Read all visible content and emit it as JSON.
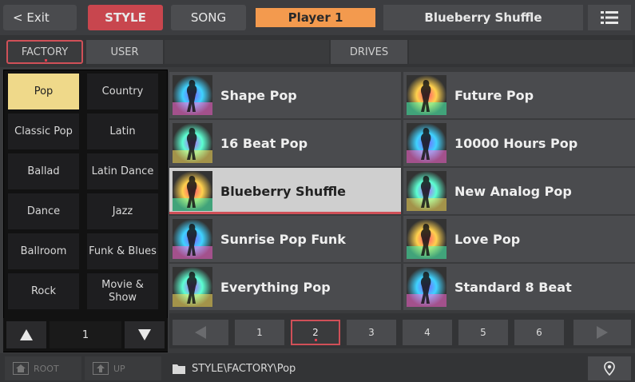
{
  "header": {
    "exit_label": "< Exit",
    "style_tab": "STYLE",
    "song_tab": "SONG",
    "player": "Player 1",
    "current_style": "Blueberry Shuffle",
    "menu_icon": "list-menu-icon"
  },
  "tabs": {
    "factory": "FACTORY",
    "user": "USER",
    "drives": "DRIVES"
  },
  "categories": [
    {
      "label": "Pop",
      "selected": true
    },
    {
      "label": "Country",
      "selected": false
    },
    {
      "label": "Classic Pop",
      "selected": false
    },
    {
      "label": "Latin",
      "selected": false
    },
    {
      "label": "Ballad",
      "selected": false
    },
    {
      "label": "Latin Dance",
      "selected": false
    },
    {
      "label": "Dance",
      "selected": false
    },
    {
      "label": "Jazz",
      "selected": false
    },
    {
      "label": "Ballroom",
      "selected": false
    },
    {
      "label": "Funk & Blues",
      "selected": false
    },
    {
      "label": "Rock",
      "selected": false
    },
    {
      "label": "Movie & Show",
      "selected": false
    }
  ],
  "category_page": "1",
  "styles": [
    {
      "name": "Shape Pop",
      "selected": false
    },
    {
      "name": "Future Pop",
      "selected": false
    },
    {
      "name": "16 Beat Pop",
      "selected": false
    },
    {
      "name": "10000 Hours Pop",
      "selected": false
    },
    {
      "name": "Blueberry Shuffle",
      "selected": true
    },
    {
      "name": "New Analog Pop",
      "selected": false
    },
    {
      "name": "Sunrise Pop Funk",
      "selected": false
    },
    {
      "name": "Love Pop",
      "selected": false
    },
    {
      "name": "Everything Pop",
      "selected": false
    },
    {
      "name": "Standard 8 Beat",
      "selected": false
    }
  ],
  "pages": [
    "1",
    "2",
    "3",
    "4",
    "5",
    "6"
  ],
  "current_page": "2",
  "bottom": {
    "root_label": "ROOT",
    "up_label": "UP",
    "path": "STYLE\\FACTORY\\Pop"
  },
  "colors": {
    "accent_red": "#c8464e",
    "player_orange": "#f39a4e",
    "category_selected": "#efd98a"
  }
}
